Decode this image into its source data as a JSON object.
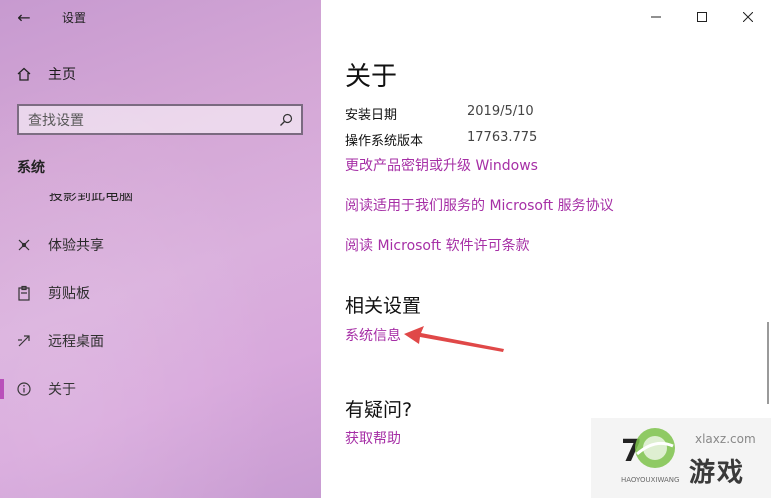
{
  "window": {
    "app_title": "设置",
    "back_label": "←",
    "caption": {
      "minimize": "—",
      "maximize": "☐",
      "close": "✕"
    }
  },
  "sidebar": {
    "home_label": "主页",
    "search": {
      "placeholder": "查找设置"
    },
    "section_title": "系统",
    "cut_item_label": "投影到此电脑",
    "items": [
      {
        "label": "体验共享",
        "icon": "share-icon"
      },
      {
        "label": "剪贴板",
        "icon": "clipboard-icon"
      },
      {
        "label": "远程桌面",
        "icon": "remote-desktop-icon"
      },
      {
        "label": "关于",
        "icon": "info-icon",
        "active": true
      }
    ]
  },
  "main": {
    "title": "关于",
    "specs": [
      {
        "key": "安装日期",
        "value": "2019/5/10"
      },
      {
        "key": "操作系统版本",
        "value": "17763.775"
      }
    ],
    "links": {
      "change_key": "更改产品密钥或升级 Windows",
      "service_agreement": "阅读适用于我们服务的 Microsoft 服务协议",
      "license_terms": "阅读 Microsoft 软件许可条款"
    },
    "related_title": "相关设置",
    "system_info_link": "系统信息",
    "question_title": "有疑问?",
    "get_help_link": "获取帮助"
  },
  "watermark": {
    "url": "xlaxz.com",
    "text": "游戏",
    "pinyin": "HAOYOUXIWANG",
    "partial": "7"
  },
  "colors": {
    "accent": "#a62fa6",
    "sidebar": "#d4a7d6",
    "annotation_arrow": "#e04848"
  }
}
